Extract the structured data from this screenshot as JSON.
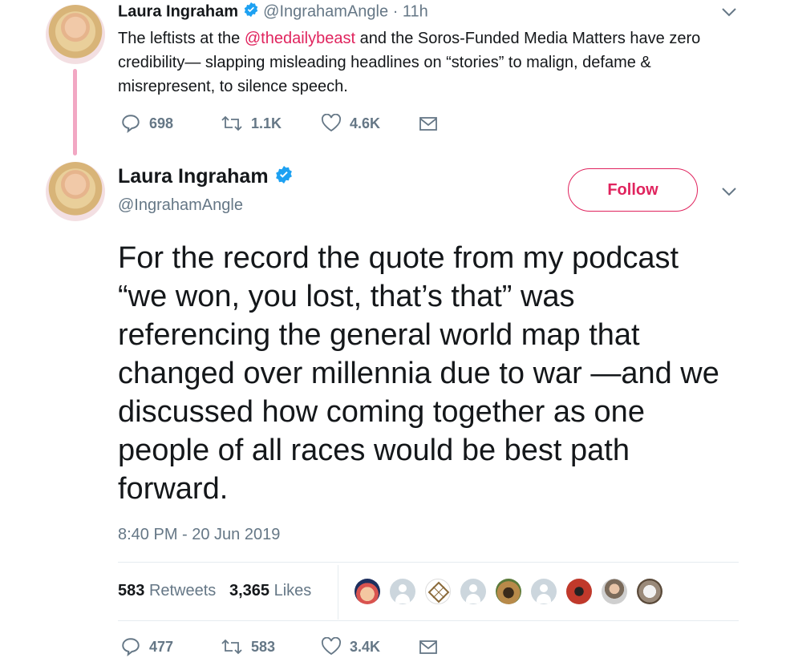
{
  "parent_tweet": {
    "name": "Laura Ingraham",
    "handle": "@IngrahamAngle",
    "time": "· 11h",
    "text_before": "The leftists at the ",
    "mention": "@thedailybeast",
    "text_after": " and the Soros-Funded Media Matters have zero credibility— slapping misleading headlines on “stories” to malign, defame & misrepresent, to silence speech.",
    "replies": "698",
    "retweets": "1.1K",
    "likes": "4.6K"
  },
  "main_tweet": {
    "name": "Laura Ingraham",
    "handle": "@IngrahamAngle",
    "follow_label": "Follow",
    "text": "For the record the quote from my podcast “we won, you lost, that’s that” was referencing the general world map that changed over millennia due to war —and we discussed how coming together as one people of all races would be best path forward.",
    "timestamp": "8:40 PM - 20 Jun 2019",
    "retweet_count": "583",
    "retweet_word": "Retweets",
    "like_count": "3,365",
    "like_word": "Likes",
    "replies": "477",
    "retweets": "583",
    "likes": "3.4K"
  },
  "colors": {
    "accent": "#e0245e",
    "verified": "#1da1f2",
    "muted": "#657786",
    "thread_line": "#f2a7c3"
  },
  "icons": [
    "reply-icon",
    "retweet-icon",
    "like-icon",
    "dm-icon",
    "chevron-down-icon",
    "verified-badge-icon"
  ]
}
